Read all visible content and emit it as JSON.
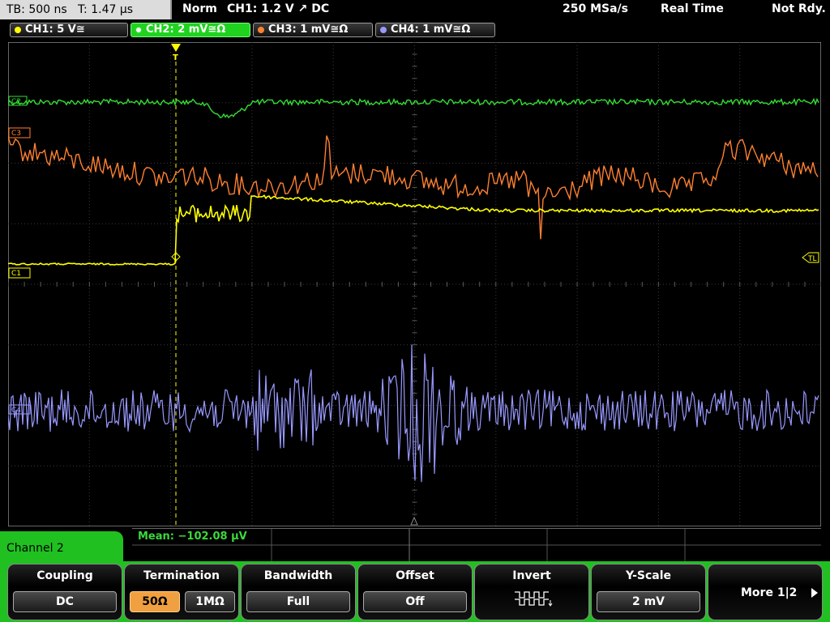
{
  "status": {
    "tb": "TB: 500 ns",
    "t": "T: 1.47 µs",
    "mode": "Norm",
    "trigger": "CH1: 1.2 V ↗ DC",
    "rate": "250 MSa/s",
    "acq": "Real Time",
    "state": "Not Rdy."
  },
  "channels": [
    {
      "label": "CH1: 5 V≅",
      "color": "#ffff00"
    },
    {
      "label": "CH2: 2 mV≅Ω",
      "color": "#33dd33"
    },
    {
      "label": "CH3: 1 mV≅Ω",
      "color": "#ff8030"
    },
    {
      "label": "CH4: 1 mV≅Ω",
      "color": "#9898ff"
    }
  ],
  "markers": {
    "c1": "C1",
    "c2": "C2",
    "c3": "C3",
    "c4": "C4",
    "trigger_level": "TL",
    "trigger_pos": "T"
  },
  "measurement": {
    "mean": "Mean: −102.08 µV"
  },
  "menu": {
    "title": "Channel 2",
    "coupling": {
      "label": "Coupling",
      "value": "DC"
    },
    "termination": {
      "label": "Termination",
      "opt1": "50Ω",
      "opt2": "1MΩ"
    },
    "bandwidth": {
      "label": "Bandwidth",
      "value": "Full"
    },
    "offset": {
      "label": "Offset",
      "value": "Off"
    },
    "invert": {
      "label": "Invert"
    },
    "yscale": {
      "label": "Y-Scale",
      "value": "2 mV"
    },
    "more": {
      "label": "More 1|2"
    }
  },
  "colors": {
    "ch1": "#ffff00",
    "ch2": "#33dd33",
    "ch3": "#ff8030",
    "ch4": "#9898ff",
    "accent": "#20c020"
  }
}
